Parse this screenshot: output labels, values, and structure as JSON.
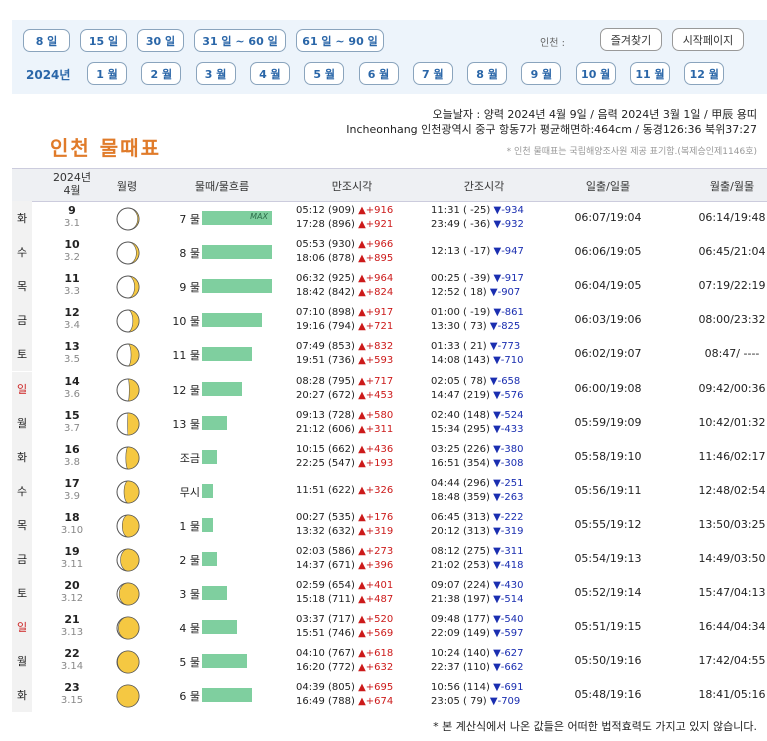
{
  "nav": {
    "range_buttons": [
      "8 일",
      "15 일",
      "30 일",
      "31 일 ~ 60 일",
      "61 일 ~ 90 일"
    ],
    "region_label": "인천  :",
    "bookmark_button": "즐겨찾기",
    "homepage_button": "시작페이지",
    "year_label": "2024년",
    "month_buttons": [
      "1 월",
      "2 월",
      "3 월",
      "4 월",
      "5 월",
      "6 월",
      "7 월",
      "8 월",
      "9 월",
      "10 월",
      "11 월",
      "12 월"
    ]
  },
  "info": {
    "today_line": "오늘날자 : 양력 2024년 4월 9일 / 음력 2024년 3월 1일 / 甲辰 용띠",
    "station_line": "Incheonhang 인천광역시 중구 항동7가 평균해면하:464cm / 동경126:36 북위37:27",
    "title": "인천  물때표",
    "source_note": "* 인천 물때표는 국립해양조사원 제공 표기함.(복제승인제1146호)"
  },
  "table_header": {
    "year": "2024년",
    "month": "4월",
    "moon_age": "월령",
    "tide": "물때/물흐름",
    "high": "만조시각",
    "low": "간조시각",
    "sunrise": "일출/일몰",
    "moonrise": "월출/월몰"
  },
  "rows": [
    {
      "wd": "화",
      "d": "9",
      "lunar": "3.1",
      "mul": "7 물",
      "flow": 1.0,
      "max": "MAX",
      "moon": 0.03,
      "h1": "05:12 (909)",
      "h1d": "▲+916",
      "h2": "17:28 (896)",
      "h2d": "▲+921",
      "l1": "11:31 ( -25)",
      "l1d": "▼-934",
      "l2": "23:49 ( -36)",
      "l2d": "▼-932",
      "sun": "06:07/19:04",
      "mr": "06:14/19:48"
    },
    {
      "wd": "수",
      "d": "10",
      "lunar": "3.2",
      "mul": "8 물",
      "flow": 1.0,
      "moon": 0.06,
      "h1": "05:53 (930)",
      "h1d": "▲+966",
      "h2": "18:06 (878)",
      "h2d": "▲+895",
      "l1": "12:13 ( -17)",
      "l1d": "▼-947",
      "l2": "",
      "l2d": "",
      "sun": "06:06/19:05",
      "mr": "06:45/21:04"
    },
    {
      "wd": "목",
      "d": "11",
      "lunar": "3.3",
      "mul": "9 물",
      "flow": 1.0,
      "moon": 0.1,
      "h1": "06:32 (925)",
      "h1d": "▲+964",
      "h2": "18:42 (842)",
      "h2d": "▲+824",
      "l1": "00:25 ( -39)",
      "l1d": "▼-917",
      "l2": "12:52 (  18)",
      "l2d": "▼-907",
      "sun": "06:04/19:05",
      "mr": "07:19/22:19"
    },
    {
      "wd": "금",
      "d": "12",
      "lunar": "3.4",
      "mul": "10 물",
      "flow": 0.86,
      "moon": 0.14,
      "h1": "07:10 (898)",
      "h1d": "▲+917",
      "h2": "19:16 (794)",
      "h2d": "▲+721",
      "l1": "01:00 ( -19)",
      "l1d": "▼-861",
      "l2": "13:30 (  73)",
      "l2d": "▼-825",
      "sun": "06:03/19:06",
      "mr": "08:00/23:32"
    },
    {
      "wd": "토",
      "d": "13",
      "lunar": "3.5",
      "mul": "11 물",
      "flow": 0.72,
      "moon": 0.18,
      "h1": "07:49 (853)",
      "h1d": "▲+832",
      "h2": "19:51 (736)",
      "h2d": "▲+593",
      "l1": "01:33 (  21)",
      "l1d": "▼-773",
      "l2": "14:08 (143)",
      "l2d": "▼-710",
      "sun": "06:02/19:07",
      "mr": "08:47/ ----"
    },
    {
      "wd": "일",
      "d": "14",
      "lunar": "3.6",
      "mul": "12 물",
      "flow": 0.57,
      "moon": 0.22,
      "sunday": true,
      "h1": "08:28 (795)",
      "h1d": "▲+717",
      "h2": "20:27 (672)",
      "h2d": "▲+453",
      "l1": "02:05 (  78)",
      "l1d": "▼-658",
      "l2": "14:47 (219)",
      "l2d": "▼-576",
      "sun": "06:00/19:08",
      "mr": "09:42/00:36"
    },
    {
      "wd": "월",
      "d": "15",
      "lunar": "3.7",
      "mul": "13 물",
      "flow": 0.36,
      "moon": 0.26,
      "h1": "09:13 (728)",
      "h1d": "▲+580",
      "h2": "21:12 (606)",
      "h2d": "▲+311",
      "l1": "02:40 (148)",
      "l1d": "▼-524",
      "l2": "15:34 (295)",
      "l2d": "▼-433",
      "sun": "05:59/19:09",
      "mr": "10:42/01:32"
    },
    {
      "wd": "화",
      "d": "16",
      "lunar": "3.8",
      "mul": "조금",
      "flow": 0.22,
      "moon": 0.3,
      "h1": "10:15 (662)",
      "h1d": "▲+436",
      "h2": "22:25 (547)",
      "h2d": "▲+193",
      "l1": "03:25 (226)",
      "l1d": "▼-380",
      "l2": "16:51 (354)",
      "l2d": "▼-308",
      "sun": "05:58/19:10",
      "mr": "11:46/02:17"
    },
    {
      "wd": "수",
      "d": "17",
      "lunar": "3.9",
      "mul": "무시",
      "flow": 0.15,
      "moon": 0.34,
      "h1": "11:51 (622)",
      "h1d": "▲+326",
      "h2": "",
      "h2d": "",
      "l1": "04:44 (296)",
      "l1d": "▼-251",
      "l2": "18:48 (359)",
      "l2d": "▼-263",
      "sun": "05:56/19:11",
      "mr": "12:48/02:54"
    },
    {
      "wd": "목",
      "d": "18",
      "lunar": "3.10",
      "mul": "1 물",
      "flow": 0.15,
      "moon": 0.38,
      "h1": "00:27 (535)",
      "h1d": "▲+176",
      "h2": "13:32 (632)",
      "h2d": "▲+319",
      "l1": "06:45 (313)",
      "l1d": "▼-222",
      "l2": "20:12 (313)",
      "l2d": "▼-319",
      "sun": "05:55/19:12",
      "mr": "13:50/03:25"
    },
    {
      "wd": "금",
      "d": "19",
      "lunar": "3.11",
      "mul": "2 물",
      "flow": 0.22,
      "moon": 0.42,
      "h1": "02:03 (586)",
      "h1d": "▲+273",
      "h2": "14:37 (671)",
      "h2d": "▲+396",
      "l1": "08:12 (275)",
      "l1d": "▼-311",
      "l2": "21:02 (253)",
      "l2d": "▼-418",
      "sun": "05:54/19:13",
      "mr": "14:49/03:50"
    },
    {
      "wd": "토",
      "d": "20",
      "lunar": "3.12",
      "mul": "3 물",
      "flow": 0.36,
      "moon": 0.45,
      "h1": "02:59 (654)",
      "h1d": "▲+401",
      "h2": "15:18 (711)",
      "h2d": "▲+487",
      "l1": "09:07 (224)",
      "l1d": "▼-430",
      "l2": "21:38 (197)",
      "l2d": "▼-514",
      "sun": "05:52/19:14",
      "mr": "15:47/04:13"
    },
    {
      "wd": "일",
      "d": "21",
      "lunar": "3.13",
      "mul": "4 물",
      "flow": 0.5,
      "moon": 0.47,
      "sunday": true,
      "h1": "03:37 (717)",
      "h1d": "▲+520",
      "h2": "15:51 (746)",
      "h2d": "▲+569",
      "l1": "09:48 (177)",
      "l1d": "▼-540",
      "l2": "22:09 (149)",
      "l2d": "▼-597",
      "sun": "05:51/19:15",
      "mr": "16:44/04:34"
    },
    {
      "wd": "월",
      "d": "22",
      "lunar": "3.14",
      "mul": "5 물",
      "flow": 0.64,
      "moon": 0.49,
      "h1": "04:10 (767)",
      "h1d": "▲+618",
      "h2": "16:20 (772)",
      "h2d": "▲+632",
      "l1": "10:24 (140)",
      "l1d": "▼-627",
      "l2": "22:37 (110)",
      "l2d": "▼-662",
      "sun": "05:50/19:16",
      "mr": "17:42/04:55"
    },
    {
      "wd": "화",
      "d": "23",
      "lunar": "3.15",
      "mul": "6 물",
      "flow": 0.72,
      "moon": 0.5,
      "h1": "04:39 (805)",
      "h1d": "▲+695",
      "h2": "16:49 (788)",
      "h2d": "▲+674",
      "l1": "10:56 (114)",
      "l1d": "▼-691",
      "l2": "23:05 (  79)",
      "l2d": "▼-709",
      "sun": "05:48/19:16",
      "mr": "18:41/05:16"
    }
  ],
  "footer_note": "* 본 계산식에서 나온 값들은 어떠한 법적효력도 가지고 있지 않습니다.",
  "colors": {
    "accent": "#2a66a8",
    "title": "#e07b2a",
    "bar": "#7fcf9f",
    "moon": "#f5c842",
    "up": "#cc1a1a",
    "down": "#1a2eb0"
  }
}
